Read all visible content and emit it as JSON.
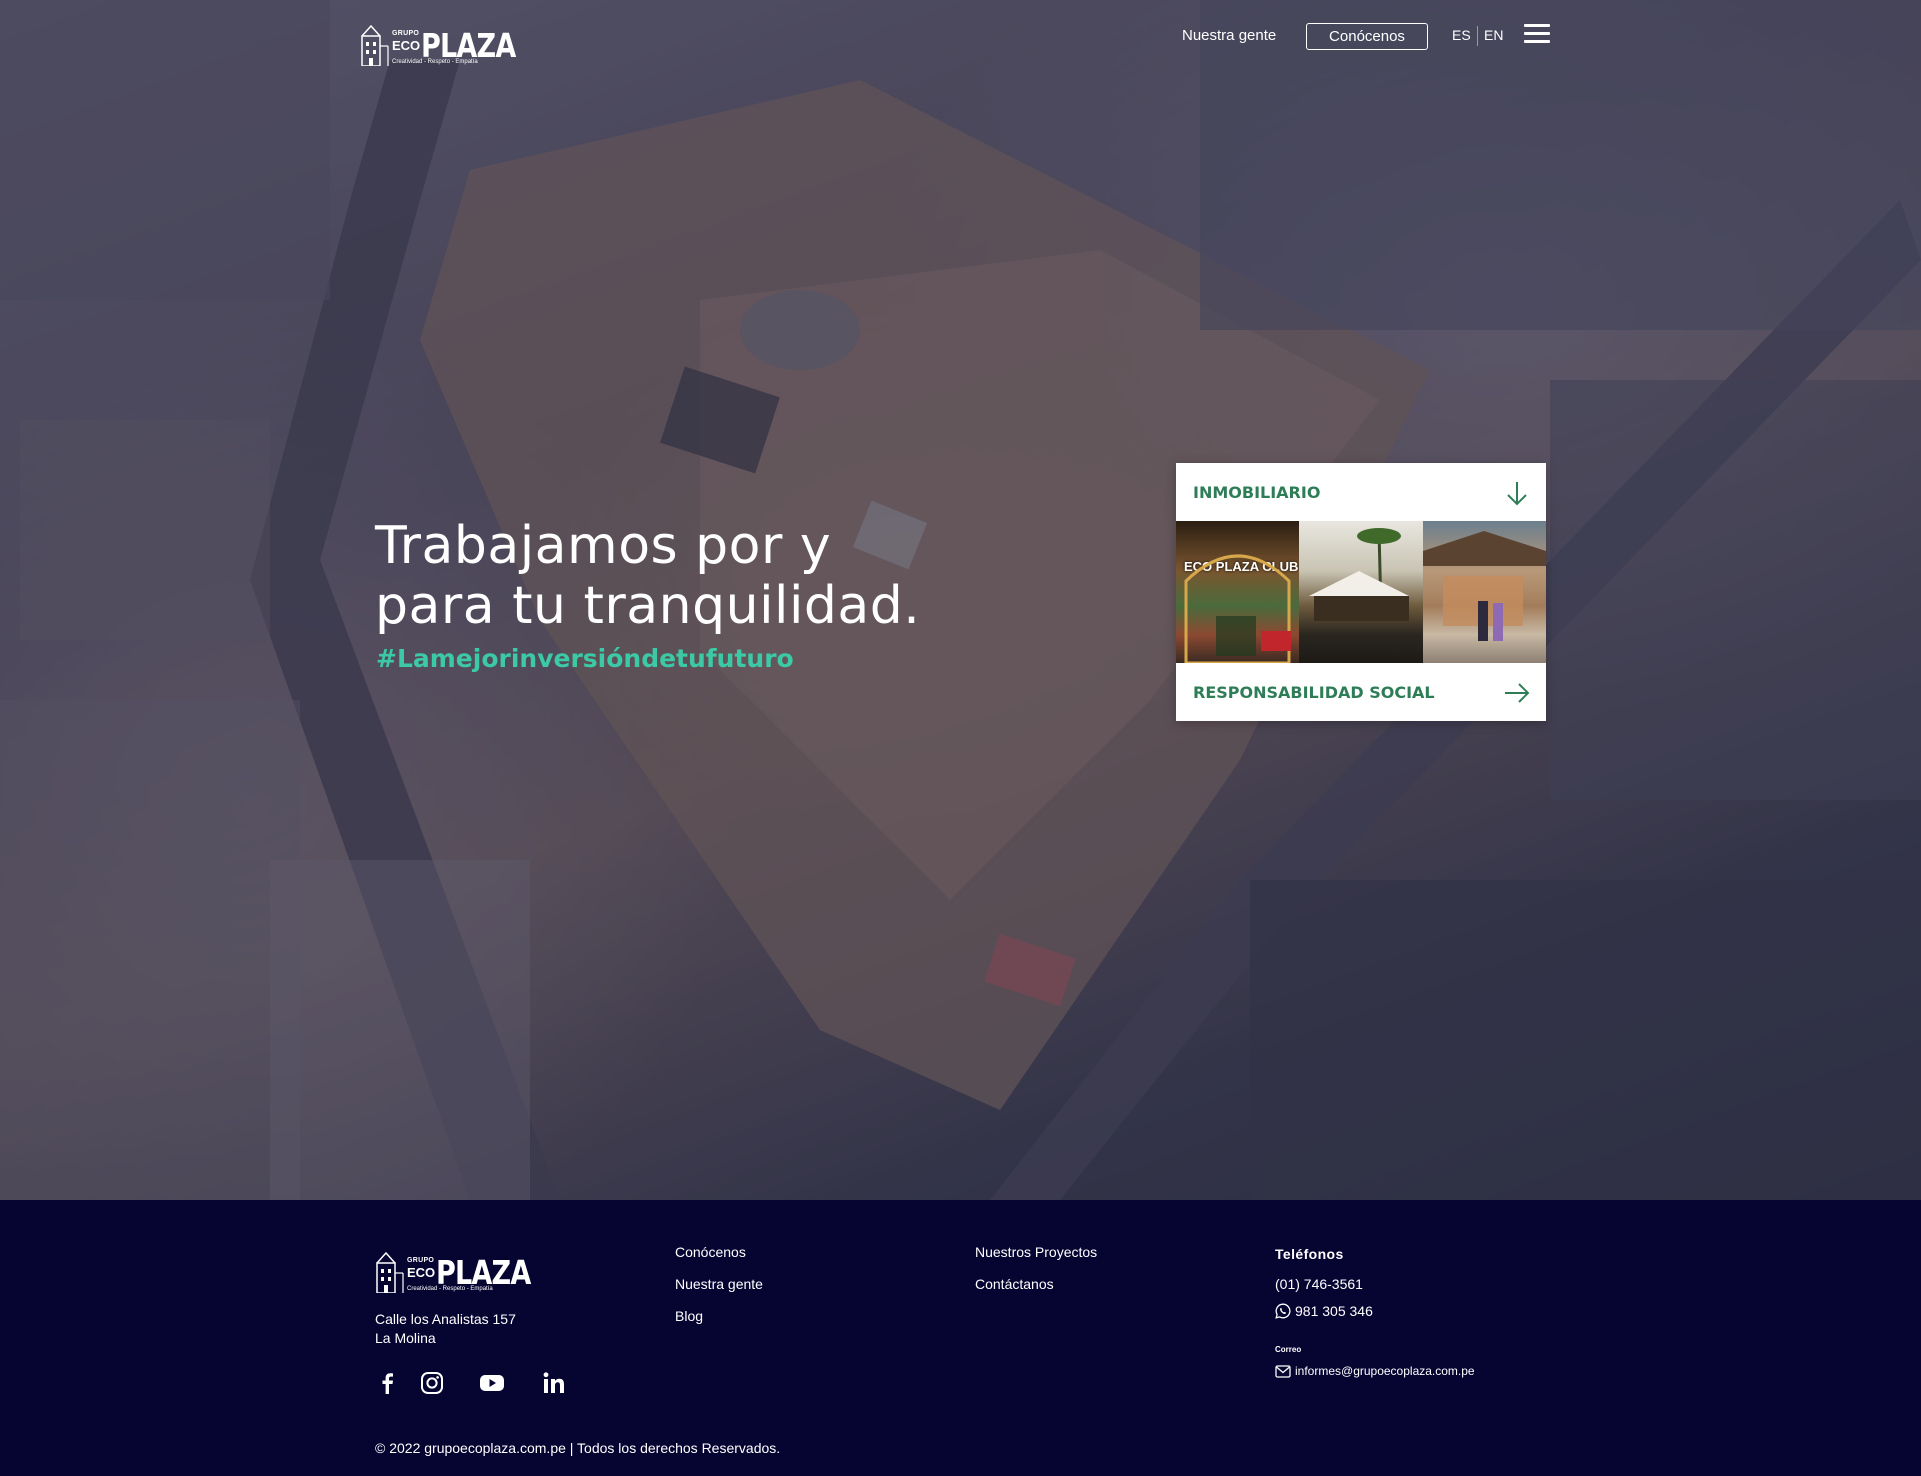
{
  "brand": {
    "grupo": "GRUPO",
    "eco": "ECO",
    "plaza": "PLAZA",
    "tagline": "Creatividad - Respeto - Empatía"
  },
  "header": {
    "nav_nuestra_gente": "Nuestra gente",
    "nav_conocenos": "Conócenos",
    "lang_es": "ES",
    "lang_en": "EN",
    "menu_icon": "hamburger-icon"
  },
  "hero": {
    "title_line1": "Trabajamos por y",
    "title_line2": "para tu tranquilidad.",
    "hashtag": "#Lamejorinversióndetufuturo"
  },
  "card": {
    "top_label": "INMOBILIARIO",
    "top_icon": "arrow-down-icon",
    "image_label": "ECO PLAZA CLUB",
    "bottom_label": "RESPONSABILIDAD SOCIAL",
    "bottom_icon": "arrow-right-icon"
  },
  "footer": {
    "address_line1": "Calle los Analistas 157",
    "address_line2": "La Molina",
    "social_icons": [
      "facebook-icon",
      "instagram-icon",
      "youtube-icon",
      "linkedin-icon"
    ],
    "col1": [
      "Conócenos",
      "Nuestra gente",
      "Blog"
    ],
    "col2": [
      "Nuestros Proyectos",
      "Contáctanos"
    ],
    "phones_heading": "Teléfonos",
    "phone": "(01) 746-3561",
    "whatsapp": "981 305 346",
    "email_heading": "Correo",
    "email": "informes@grupoecoplaza.com.pe",
    "copyright": "© 2022 grupoecoplaza.com.pe | Todos los derechos Reservados."
  },
  "colors": {
    "accent_green": "#3cc9a5",
    "card_text_green": "#2e7d57",
    "footer_bg": "#060431"
  }
}
